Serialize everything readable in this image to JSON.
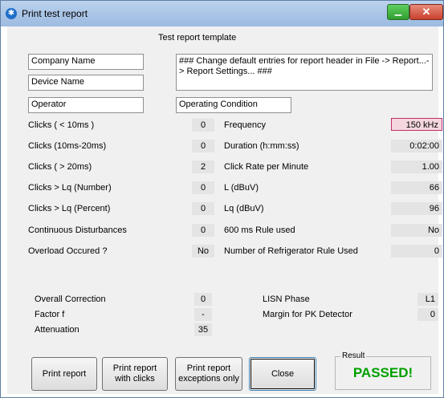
{
  "window": {
    "title": "Print test report",
    "app_icon": "bluetooth-like-icon",
    "min_label": "▁",
    "close_label": "✕"
  },
  "template": {
    "label": "Test report template",
    "company": "Company Name",
    "device": "Device Name",
    "operator": "Operator",
    "header_note": "### Change default entries for report header in File -> Report...-> Report Settings... ###",
    "operating_condition": "Operating Condition"
  },
  "left_rows": [
    {
      "label": "Clicks ( < 10ms )",
      "value": "0"
    },
    {
      "label": "Clicks (10ms-20ms)",
      "value": "0"
    },
    {
      "label": "Clicks ( > 20ms)",
      "value": "2"
    },
    {
      "label": "Clicks  > Lq (Number)",
      "value": "0"
    },
    {
      "label": "Clicks  > Lq (Percent)",
      "value": "0"
    },
    {
      "label": "Continuous Disturbances",
      "value": "0"
    },
    {
      "label": "Overload Occured ?",
      "value": "No"
    }
  ],
  "right_rows": [
    {
      "label": "Frequency",
      "value": "150 kHz"
    },
    {
      "label": "Duration (h:mm:ss)",
      "value": "0:02:00"
    },
    {
      "label": "Click Rate per Minute",
      "value": "1.00"
    },
    {
      "label": "L (dBuV)",
      "value": "66"
    },
    {
      "label": "Lq (dBuV)",
      "value": "96"
    },
    {
      "label": "600 ms Rule used",
      "value": "No"
    },
    {
      "label": "Number of Refrigerator Rule Used",
      "value": "0"
    }
  ],
  "bottom_left": [
    {
      "label": "Overall Correction",
      "value": "0"
    },
    {
      "label": "Factor f",
      "value": "-"
    },
    {
      "label": "Attenuation",
      "value": "35"
    }
  ],
  "bottom_right": [
    {
      "label": "LISN Phase",
      "value": "L1"
    },
    {
      "label": "Margin for PK Detector",
      "value": "0"
    }
  ],
  "buttons": {
    "print_report": "Print report",
    "print_with_clicks_1": "Print report",
    "print_with_clicks_2": "with clicks",
    "print_exceptions_1": "Print report",
    "print_exceptions_2": "exceptions only",
    "close": "Close"
  },
  "result": {
    "group_label": "Result",
    "value": "PASSED!",
    "color": "#00a000"
  }
}
